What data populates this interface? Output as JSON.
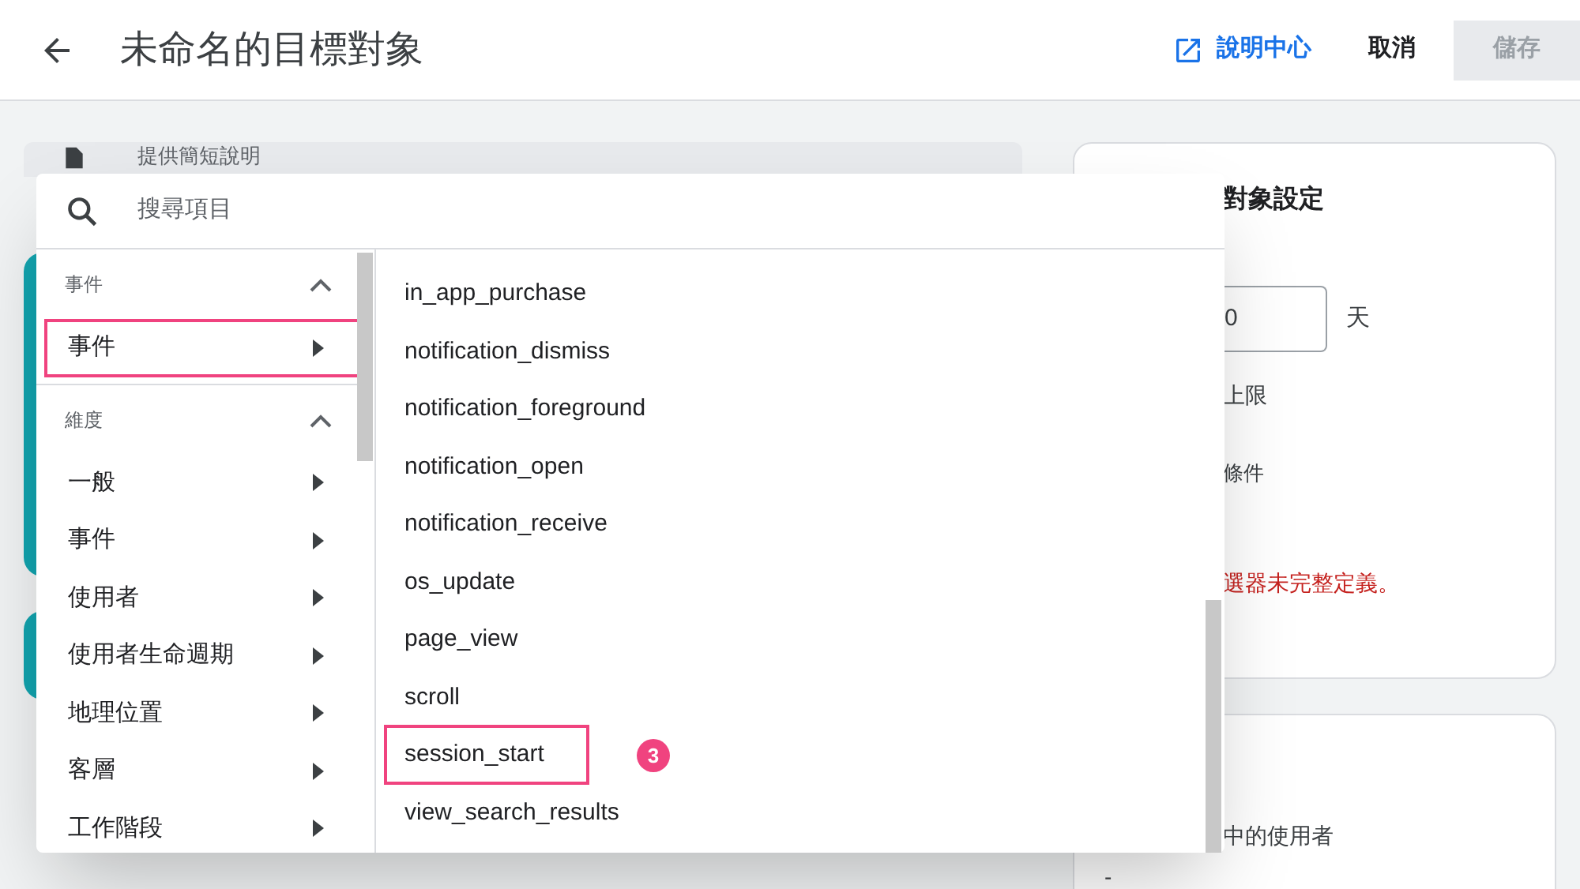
{
  "header": {
    "title": "未命名的目標對象",
    "help_link": "說明中心",
    "cancel": "取消",
    "save": {
      "label": "儲存",
      "disabled": true
    }
  },
  "background": {
    "description": "提供簡短說明",
    "settings_card": {
      "title": "對象設定",
      "duration_value": "0",
      "duration_unit": "天",
      "lines": [
        "上限",
        "條件"
      ],
      "error": "選器未完整定義。"
    },
    "members_card": {
      "label": "中的使用者",
      "value": "-"
    }
  },
  "picker": {
    "search_placeholder": "搜尋項目",
    "sections": [
      {
        "title": "事件",
        "expanded": true,
        "items": [
          {
            "label": "事件",
            "highlighted": true
          }
        ]
      },
      {
        "title": "維度",
        "expanded": true,
        "items": [
          {
            "label": "一般",
            "highlighted": false
          },
          {
            "label": "事件",
            "highlighted": false
          },
          {
            "label": "使用者",
            "highlighted": false
          },
          {
            "label": "使用者生命週期",
            "highlighted": false
          },
          {
            "label": "地理位置",
            "highlighted": false
          },
          {
            "label": "客層",
            "highlighted": false
          },
          {
            "label": "工作階段",
            "highlighted": false
          }
        ]
      }
    ],
    "events": [
      {
        "label": "in_app_purchase",
        "highlighted": false
      },
      {
        "label": "notification_dismiss",
        "highlighted": false
      },
      {
        "label": "notification_foreground",
        "highlighted": false
      },
      {
        "label": "notification_open",
        "highlighted": false
      },
      {
        "label": "notification_receive",
        "highlighted": false
      },
      {
        "label": "os_update",
        "highlighted": false
      },
      {
        "label": "page_view",
        "highlighted": false
      },
      {
        "label": "scroll",
        "highlighted": false
      },
      {
        "label": "session_start",
        "highlighted": true,
        "step": "3"
      },
      {
        "label": "view_search_results",
        "highlighted": false
      }
    ]
  }
}
